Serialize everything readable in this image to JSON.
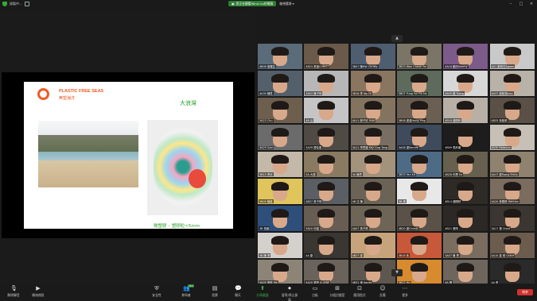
{
  "topbar": {
    "window_title": "錄製中...",
    "recording_pill": "您正在觀看Wind Liu的螢幕",
    "view_options": "檢視選項"
  },
  "slide": {
    "title": "PLASTIC FREE SEAS",
    "subtitle": "無塑海洋",
    "location": "大浪灣",
    "caption": "微塑膠 – 塑膠粒<5mm"
  },
  "gallery": {
    "participants": [
      {
        "name": "4B06 曾羅芸",
        "color": "#5a6b7a"
      },
      {
        "name": "4B23 黃晉CHRIST",
        "color": "#6b5a4a"
      },
      {
        "name": "3B07 陳HW Christy",
        "color": "#4f5d70"
      },
      {
        "name": "3B23 Wan Cheuk Yin",
        "color": "#7a7566"
      },
      {
        "name": "4A16 穎欣Kimmy",
        "color": "#7c5a8a"
      },
      {
        "name": "4A1 劉靖汶Agnes",
        "color": "#c9c9c9"
      },
      {
        "name": "4A30 陳陞",
        "color": "#53606b"
      },
      {
        "name": "4B03 陳子晴",
        "color": "#b7b7b7"
      },
      {
        "name": "3B18 李 Ng Ch",
        "color": "#8a7560"
      },
      {
        "name": "5B07 Yung Yui Yin Ho",
        "color": "#5d6a5c"
      },
      {
        "name": "4A05 葉 Tsang",
        "color": "#d7d7d7"
      },
      {
        "name": "4A37 盧凱喬Joey",
        "color": "#b9b2a8"
      },
      {
        "name": "3A23 Chu",
        "color": "#6e5e4e"
      },
      {
        "name": "4B 谷 ",
        "color": "#c5c5c5"
      },
      {
        "name": "4A11 鄭子欣 Yuiki",
        "color": "#84735e"
      },
      {
        "name": "3B08 梁貞Hung Ying",
        "color": "#6b5f53"
      },
      {
        "name": "4B18 鍾曉晴",
        "color": "#b8b0a6"
      },
      {
        "name": "4B33 朱凱晴",
        "color": "#5a5046"
      },
      {
        "name": "4A29 Sum",
        "color": "#6b6b6b"
      },
      {
        "name": "3A29 譚佳盈",
        "color": "#4f4a44"
      },
      {
        "name": "3A11 李思穎 Kay Ling Tang",
        "color": "#786e62"
      },
      {
        "name": "5A08 梁Bennie",
        "color": "#3f4b5c"
      },
      {
        "name": "4B09 馬鈴薯",
        "color": "#1d1d1d"
      },
      {
        "name": "4A30 Rebecca",
        "color": "#c7c0b6"
      },
      {
        "name": "3B15 李欣",
        "color": "#c4b8a8"
      },
      {
        "name": "5A 大蓮",
        "color": "#8a7a62"
      },
      {
        "name": "3A 陳思",
        "color": "#a3927c"
      },
      {
        "name": "3B33 Yan Kit",
        "color": "#4e6b86"
      },
      {
        "name": "4B26 何恩 Ea",
        "color": "#67604f"
      },
      {
        "name": "4A17 梁Tsang Emily",
        "color": "#8f826f"
      },
      {
        "name": "5B09 陳葉",
        "color": "#e0c45c"
      },
      {
        "name": "4B27 黃子晴",
        "color": "#5b5e63"
      },
      {
        "name": "4B 沈 陳 ",
        "color": "#6b6356"
      },
      {
        "name": "3B 周",
        "color": "#e8e8e8"
      },
      {
        "name": "4B14 鍾曉晴",
        "color": "#2e2a26"
      },
      {
        "name": "4A20 林曉晴 Hannah",
        "color": "#7a6c5e"
      },
      {
        "name": "3B 黃穎",
        "color": "#2d4f7a"
      },
      {
        "name": "5B20 何諾",
        "color": "#675d52"
      },
      {
        "name": "4A07 黃子晴",
        "color": "#6e6557"
      },
      {
        "name": "4B20 梁Christy",
        "color": "#5a5249"
      },
      {
        "name": "4B21 樂晴",
        "color": "#2b2825"
      },
      {
        "name": "3A17 楊 Chloe",
        "color": "#3b3631"
      },
      {
        "name": "3B 陳 恩",
        "color": "#d4d1cc"
      },
      {
        "name": "4A 劉",
        "color": "#3a3632"
      },
      {
        "name": "4B27 梁 ",
        "color": "#c7a37c"
      },
      {
        "name": "3B18 朱",
        "color": "#c7583a"
      },
      {
        "name": "3A07 陳 恩",
        "color": "#7a6d5f"
      },
      {
        "name": "4A10 梁 晴 Grace",
        "color": "#6b5c4e"
      },
      {
        "name": "5A05 黃凱 Ma",
        "color": "#8d8478"
      },
      {
        "name": "4A20 梁晴 ELAINE",
        "color": "#6a635b"
      },
      {
        "name": "4B31 潘 Agnes",
        "color": "#5d574f"
      },
      {
        "name": "5B22 Hin",
        "color": "#d78a2e"
      },
      {
        "name": "4A 楊",
        "color": "#6e665d"
      },
      {
        "name": "4A 蔡 ",
        "color": "#2a2a2a"
      },
      {
        "name": "5A20 張寶兒 CHIA",
        "color": "#7e7568"
      },
      {
        "name": "4A21 江 黃",
        "color": "#a79a8a"
      },
      {
        "name": "3A 黃 穎",
        "color": "#5d5349"
      },
      {
        "name": "4B 陳 Yuen SHANG",
        "color": "#b57a3e"
      },
      {
        "name": "4B01 林",
        "color": "#4a4540"
      },
      {
        "name": "4A18 陳 Ver",
        "color": "#b7b1a8"
      }
    ]
  },
  "toolbar": {
    "mute": "解除靜音",
    "video": "開始視訊",
    "security": "安全性",
    "participants": "參與者",
    "participants_count": "263",
    "polls": "投票",
    "chat": "聊天",
    "share": "分享畫面",
    "record": "暫停/停止錄製",
    "reactions": "分組討論室",
    "rooms": "反應",
    "apps": "白板",
    "whiteboard": "應用程式",
    "more": "更多",
    "end": "結束"
  }
}
